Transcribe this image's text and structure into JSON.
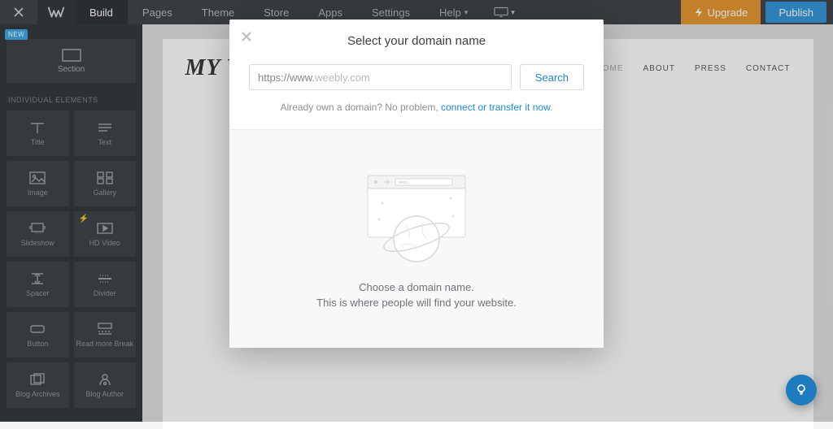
{
  "topbar": {
    "tabs": [
      "Build",
      "Pages",
      "Theme",
      "Store",
      "Apps",
      "Settings",
      "Help"
    ],
    "active": "Build",
    "upgrade": "Upgrade",
    "publish": "Publish"
  },
  "sidebar": {
    "new_badge": "NEW",
    "section_label": "Section",
    "header": "INDIVIDUAL ELEMENTS",
    "items": [
      {
        "label": "Title",
        "icon": "title"
      },
      {
        "label": "Text",
        "icon": "text"
      },
      {
        "label": "Image",
        "icon": "image"
      },
      {
        "label": "Gallery",
        "icon": "gallery"
      },
      {
        "label": "Slideshow",
        "icon": "slideshow"
      },
      {
        "label": "HD Video",
        "icon": "hdvideo",
        "premium": true
      },
      {
        "label": "Spacer",
        "icon": "spacer"
      },
      {
        "label": "Divider",
        "icon": "divider"
      },
      {
        "label": "Button",
        "icon": "button"
      },
      {
        "label": "Read more Break",
        "icon": "readmore"
      },
      {
        "label": "Blog Archives",
        "icon": "archives"
      },
      {
        "label": "Blog Author",
        "icon": "author"
      }
    ]
  },
  "site": {
    "title": "MY W",
    "nav": [
      "HOME",
      "ABOUT",
      "PRESS",
      "CONTACT"
    ]
  },
  "modal": {
    "title": "Select your domain name",
    "prefix": "https://www.",
    "suffix": "weebly.com",
    "search": "Search",
    "already": "Already own a domain? No problem, ",
    "connect": "connect or transfer it now",
    "line1": "Choose a domain name.",
    "line2": "This is where people will find your website."
  }
}
